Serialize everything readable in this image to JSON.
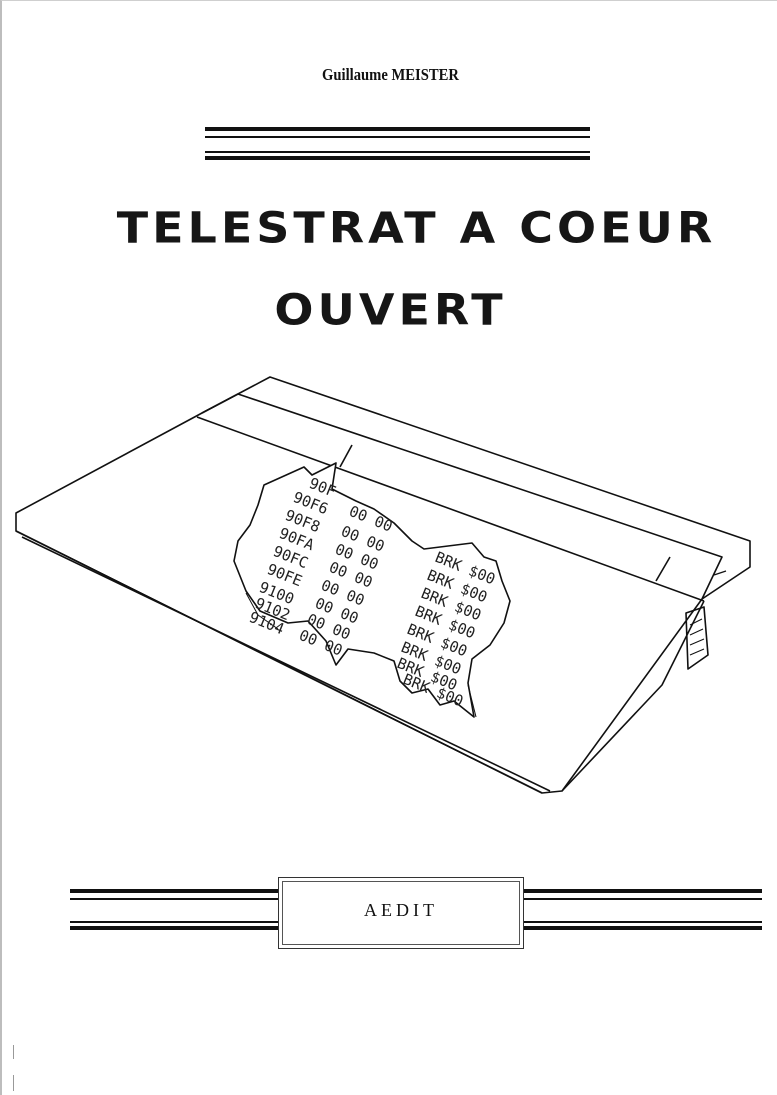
{
  "author": "Guillaume MEISTER",
  "title_line1": "TELESTRAT A COEUR",
  "title_line2": "OUVERT",
  "publisher": "AEDIT",
  "illustration": {
    "addresses": [
      "90F",
      "90F6",
      "90F8",
      "90FA",
      "90FC",
      "90FE",
      "9100",
      "9102",
      "9104",
      "910"
    ],
    "bytes": [
      "00 00",
      "00 00",
      "00 00",
      "00 00",
      "00 00",
      "00 00",
      "00 00",
      "00 00"
    ],
    "mnemonics": [
      "BRK $00",
      "BRK $00",
      "BRK $00",
      "BRK $00",
      "BRK $00",
      "BRK $00",
      "BRK $00",
      "BRK $00"
    ]
  }
}
